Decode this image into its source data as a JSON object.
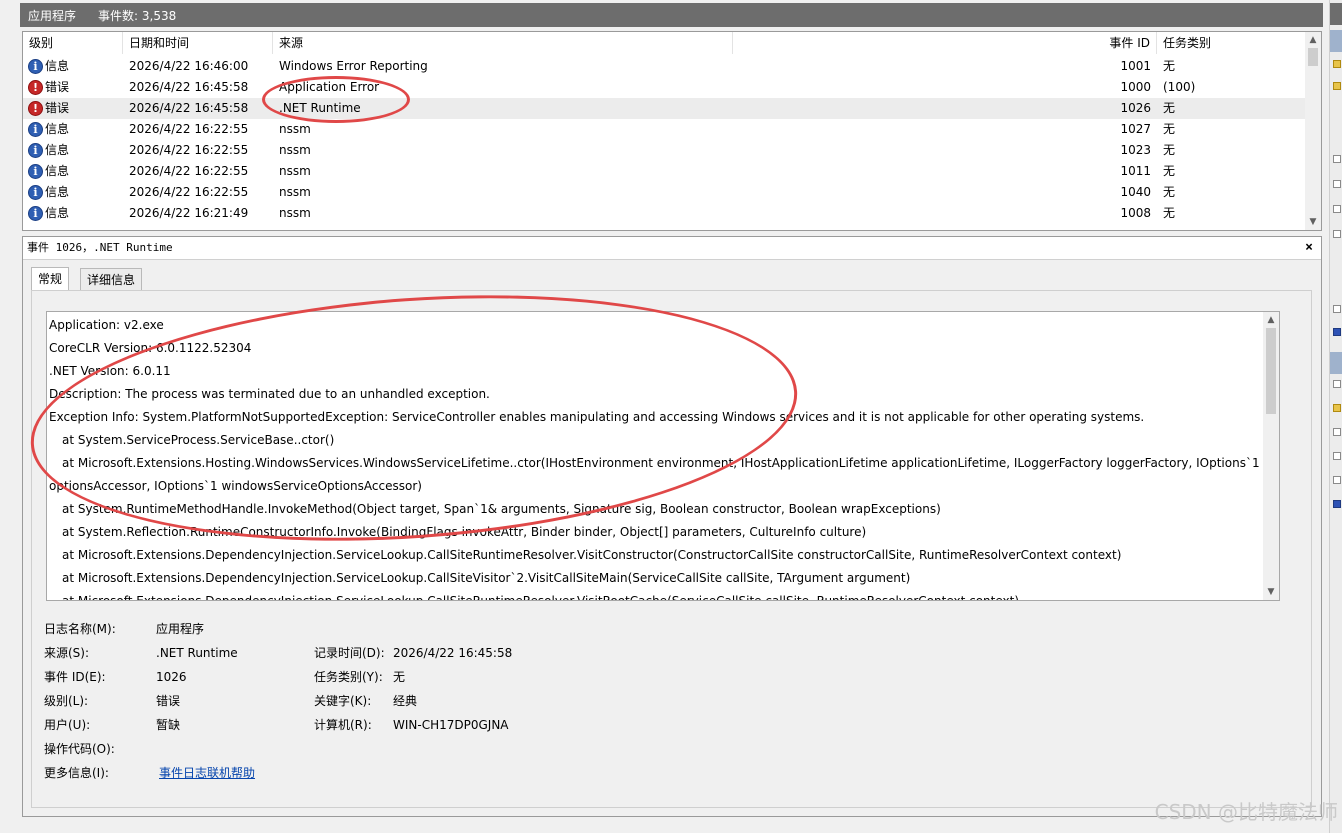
{
  "topbar": {
    "title": "应用程序",
    "event_count": "事件数: 3,538"
  },
  "list": {
    "columns": [
      "级别",
      "日期和时间",
      "来源",
      "事件 ID",
      "任务类别"
    ],
    "rows": [
      {
        "level": "信息",
        "icon": "info-icon",
        "datetime": "2026/4/22 16:46:00",
        "source": "Windows Error Reporting",
        "event_id": "1001",
        "task": "无"
      },
      {
        "level": "错误",
        "icon": "error-icon",
        "datetime": "2026/4/22 16:45:58",
        "source": "Application Error",
        "event_id": "1000",
        "task": "(100)"
      },
      {
        "level": "错误",
        "icon": "error-icon",
        "datetime": "2026/4/22 16:45:58",
        "source": ".NET Runtime",
        "event_id": "1026",
        "task": "无"
      },
      {
        "level": "信息",
        "icon": "info-icon",
        "datetime": "2026/4/22 16:22:55",
        "source": "nssm",
        "event_id": "1027",
        "task": "无"
      },
      {
        "level": "信息",
        "icon": "info-icon",
        "datetime": "2026/4/22 16:22:55",
        "source": "nssm",
        "event_id": "1023",
        "task": "无"
      },
      {
        "level": "信息",
        "icon": "info-icon",
        "datetime": "2026/4/22 16:22:55",
        "source": "nssm",
        "event_id": "1011",
        "task": "无"
      },
      {
        "level": "信息",
        "icon": "info-icon",
        "datetime": "2026/4/22 16:22:55",
        "source": "nssm",
        "event_id": "1040",
        "task": "无"
      },
      {
        "level": "信息",
        "icon": "info-icon",
        "datetime": "2026/4/22 16:21:49",
        "source": "nssm",
        "event_id": "1008",
        "task": "无"
      }
    ]
  },
  "detail": {
    "title": "事件 1026，.NET Runtime",
    "close": "×",
    "tabs": [
      "常规",
      "详细信息"
    ],
    "description": [
      "Application: v2.exe",
      "CoreCLR Version: 6.0.1122.52304",
      ".NET Version: 6.0.11",
      "Description: The process was terminated due to an unhandled exception.",
      "Exception Info: System.PlatformNotSupportedException: ServiceController enables manipulating and accessing Windows services and it is not applicable for other operating systems.",
      "at System.ServiceProcess.ServiceBase..ctor()",
      "at Microsoft.Extensions.Hosting.WindowsServices.WindowsServiceLifetime..ctor(IHostEnvironment environment, IHostApplicationLifetime applicationLifetime, ILoggerFactory loggerFactory, IOptions`1",
      "optionsAccessor, IOptions`1 windowsServiceOptionsAccessor)",
      "at System.RuntimeMethodHandle.InvokeMethod(Object target, Span`1& arguments, Signature sig, Boolean constructor, Boolean wrapExceptions)",
      "at System.Reflection.RuntimeConstructorInfo.Invoke(BindingFlags invokeAttr, Binder binder, Object[] parameters, CultureInfo culture)",
      "at Microsoft.Extensions.DependencyInjection.ServiceLookup.CallSiteRuntimeResolver.VisitConstructor(ConstructorCallSite constructorCallSite, RuntimeResolverContext context)",
      "at Microsoft.Extensions.DependencyInjection.ServiceLookup.CallSiteVisitor`2.VisitCallSiteMain(ServiceCallSite callSite, TArgument argument)",
      "at Microsoft.Extensions.DependencyInjection.ServiceLookup.CallSiteRuntimeResolver.VisitRootCache(ServiceCallSite callSite, RuntimeResolverContext context)"
    ],
    "indented_lines": [
      5,
      6,
      8,
      9,
      10,
      11,
      12
    ],
    "fields": {
      "log_name_label": "日志名称(M):",
      "log_name": "应用程序",
      "source_label": "来源(S):",
      "source": ".NET Runtime",
      "logged_label": "记录时间(D):",
      "logged": "2026/4/22 16:45:58",
      "event_id_label": "事件 ID(E):",
      "event_id": "1026",
      "task_label": "任务类别(Y):",
      "task": "无",
      "level_label": "级别(L):",
      "level": "错误",
      "keywords_label": "关键字(K):",
      "keywords": "经典",
      "user_label": "用户(U):",
      "user": "暂缺",
      "computer_label": "计算机(R):",
      "computer": "WIN-CH17DP0GJNA",
      "opcode_label": "操作代码(O):",
      "more_info_label": "更多信息(I):",
      "more_info_link": "事件日志联机帮助"
    }
  },
  "watermark": "CSDN @比特魔法师",
  "colors": {
    "annotation": "#e04848",
    "titlebar": "#6d6d6d",
    "link": "#0645ad"
  }
}
